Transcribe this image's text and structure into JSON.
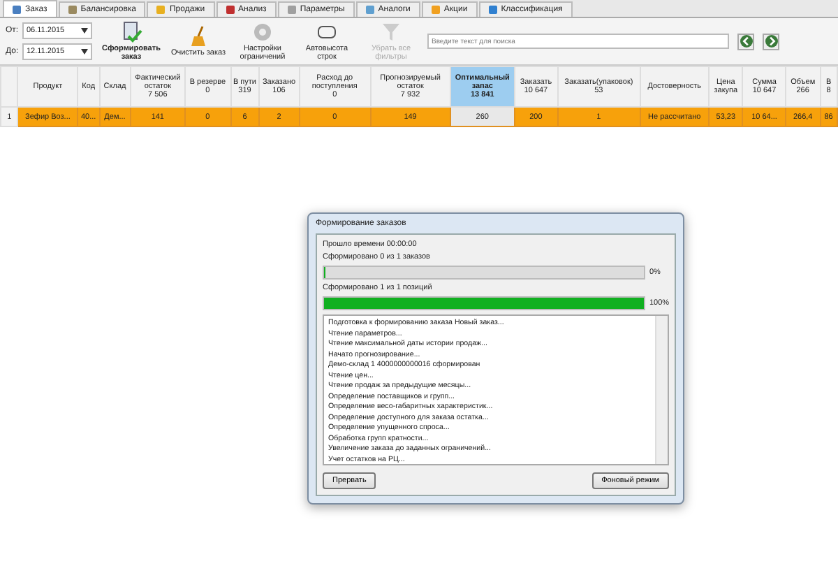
{
  "tabs": [
    {
      "label": "Заказ",
      "selected": true
    },
    {
      "label": "Балансировка",
      "selected": false
    },
    {
      "label": "Продажи",
      "selected": false
    },
    {
      "label": "Анализ",
      "selected": false
    },
    {
      "label": "Параметры",
      "selected": false
    },
    {
      "label": "Аналоги",
      "selected": false
    },
    {
      "label": "Акции",
      "selected": false
    },
    {
      "label": "Классификация",
      "selected": false
    }
  ],
  "dates": [
    {
      "label": "От:",
      "value": "06.11.2015"
    },
    {
      "label": "До:",
      "value": "12.11.2015"
    }
  ],
  "toolbar": [
    {
      "label": "Сформировать заказ",
      "kind": "primary",
      "disabled": false
    },
    {
      "label": "Очистить заказ",
      "kind": "broom",
      "disabled": false
    },
    {
      "label": "Настройки ограничений",
      "kind": "gear",
      "disabled": false
    },
    {
      "label": "Автовысота строк",
      "kind": "resize",
      "disabled": false
    },
    {
      "label": "Убрать все фильтры",
      "kind": "filter",
      "disabled": true
    }
  ],
  "search": {
    "placeholder": "Введите текст для поиска"
  },
  "table": {
    "columns": [
      {
        "label": "Продукт",
        "selected": false
      },
      {
        "label": "Код",
        "selected": false
      },
      {
        "label": "Склад",
        "selected": false
      },
      {
        "label": "Фактический остаток",
        "total": "7 506",
        "selected": false
      },
      {
        "label": "В резерве",
        "total": "0",
        "selected": false
      },
      {
        "label": "В пути",
        "total": "319",
        "selected": false
      },
      {
        "label": "Заказано",
        "total": "106",
        "selected": false
      },
      {
        "label": "Расход до поступления",
        "total": "0",
        "selected": false
      },
      {
        "label": "Прогнозируемый остаток",
        "total": "7 932",
        "selected": false
      },
      {
        "label": "Оптимальный запас",
        "total": "13 841",
        "selected": true
      },
      {
        "label": "Заказать",
        "total": "10 647",
        "selected": false
      },
      {
        "label": "Заказать(упаковок)",
        "total": "53",
        "selected": false
      },
      {
        "label": "Достоверность",
        "selected": false
      },
      {
        "label": "Цена закупа",
        "selected": false
      },
      {
        "label": "Сумма",
        "total": "10 647",
        "selected": false
      },
      {
        "label": "Объем",
        "total": "266",
        "selected": false
      },
      {
        "label": "В",
        "total": "8",
        "selected": false
      }
    ],
    "rows": [
      {
        "number": "1",
        "cells": [
          "Зефир Воз...",
          "40...",
          "Дем...",
          "141",
          "0",
          "6",
          "2",
          "0",
          "149",
          "260",
          "200",
          "1",
          "Не рассчитано",
          "53,23",
          "10 64...",
          "266,4",
          "86"
        ]
      }
    ]
  },
  "dialog": {
    "title": "Формирование заказов",
    "elapsed": "Прошло времени 00:00:00",
    "progress": [
      {
        "caption": "Сформировано 0 из 1 заказов",
        "level": 0,
        "reading": "0%"
      },
      {
        "caption": "Сформировано 1 из 1 позиций",
        "level": 1,
        "reading": "100%"
      }
    ],
    "log": [
      "Подготовка к формированию заказа Новый заказ...",
      "Чтение параметров...",
      "Чтение максимальной даты истории продаж...",
      "Начато прогнозирование...",
      "Демо-склад 1 4000000000016 сформирован",
      "Чтение цен...",
      "Чтение продаж за предыдущие месяцы...",
      "Определение поставщиков и групп...",
      "Определение весо-габаритных характеристик...",
      "Определение доступного для заказа остатка...",
      "Определение упущенного спроса...",
      "Обработка групп кратности...",
      "Увеличение заказа до заданных ограничений...",
      "Учет остатков на РЦ..."
    ],
    "buttons": [
      "Прервать",
      "Фоновый режим"
    ]
  }
}
